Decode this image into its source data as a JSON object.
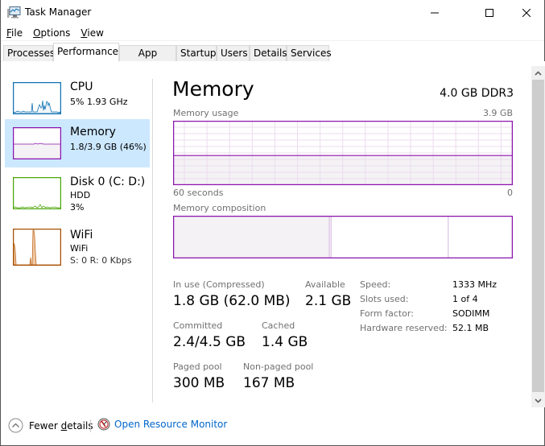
{
  "window": {
    "title": "Task Manager",
    "controls": {
      "minimize": "minimize",
      "maximize": "maximize",
      "close": "close"
    }
  },
  "menu": [
    {
      "label": "File",
      "accel": "F",
      "rest": "ile"
    },
    {
      "label": "Options",
      "accel": "O",
      "rest": "ptions"
    },
    {
      "label": "View",
      "accel": "V",
      "rest": "iew"
    }
  ],
  "tabs": [
    {
      "label": "Processes",
      "active": false
    },
    {
      "label": "Performance",
      "active": true
    },
    {
      "label": "App history",
      "active": false
    },
    {
      "label": "Startup",
      "active": false
    },
    {
      "label": "Users",
      "active": false
    },
    {
      "label": "Details",
      "active": false
    },
    {
      "label": "Services",
      "active": false
    }
  ],
  "sidebar": {
    "items": [
      {
        "name": "CPU",
        "line1": "5% 1.93 GHz",
        "line2": "",
        "color": "#1171b2",
        "selected": false
      },
      {
        "name": "Memory",
        "line1": "1.8/3.9 GB (46%)",
        "line2": "",
        "color": "#8b12ae",
        "selected": true
      },
      {
        "name": "Disk 0 (C: D:)",
        "line1": "HDD",
        "line2": "3%",
        "color": "#4da60c",
        "selected": false
      },
      {
        "name": "WiFi",
        "line1": "WiFi",
        "line2": "S: 0 R: 0 Kbps",
        "color": "#a74f01",
        "selected": false
      }
    ]
  },
  "main": {
    "title": "Memory",
    "subtitle": "4.0 GB DDR3",
    "usage_label": "Memory usage",
    "usage_max": "3.9 GB",
    "time_left": "60 seconds",
    "time_right": "0",
    "usage_fraction": 0.46,
    "composition_label": "Memory composition",
    "composition": {
      "in_use_fraction": 0.46,
      "modified_fraction": 0.005,
      "standby_fraction": 0.345
    },
    "accent": "#8b12ae",
    "stats": {
      "in_use_label": "In use (Compressed)",
      "in_use_value": "1.8 GB (62.0 MB)",
      "available_label": "Available",
      "available_value": "2.1 GB",
      "committed_label": "Committed",
      "committed_value": "2.4/4.5 GB",
      "cached_label": "Cached",
      "cached_value": "1.4 GB",
      "paged_label": "Paged pool",
      "paged_value": "300 MB",
      "nonpaged_label": "Non-paged pool",
      "nonpaged_value": "167 MB"
    },
    "specs": [
      {
        "label": "Speed:",
        "value": "1333 MHz"
      },
      {
        "label": "Slots used:",
        "value": "1 of 4"
      },
      {
        "label": "Form factor:",
        "value": "SODIMM"
      },
      {
        "label": "Hardware reserved:",
        "value": "52.1 MB"
      }
    ]
  },
  "footer": {
    "fewer_details": "Fewer details",
    "fewer_accel": "d",
    "resource_monitor": "Open Resource Monitor"
  }
}
